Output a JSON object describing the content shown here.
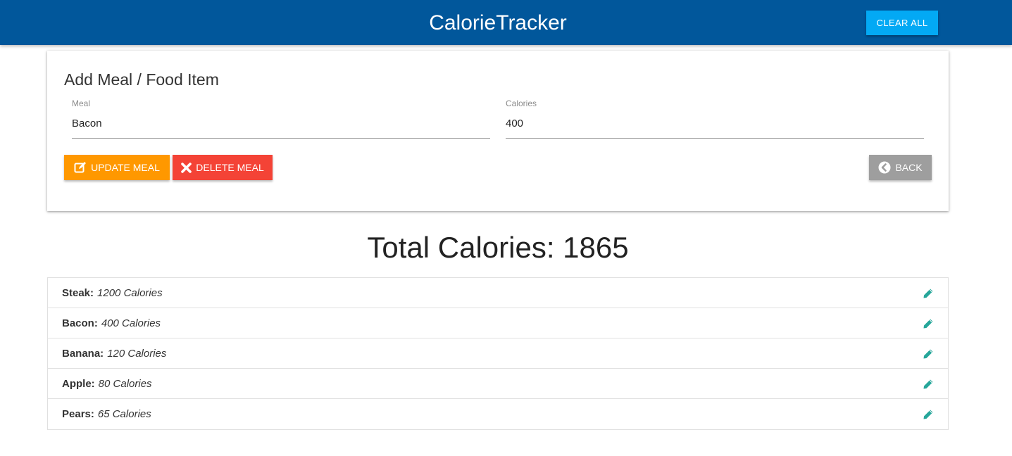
{
  "navbar": {
    "brand": "CalorieTracker",
    "clear_all": "CLEAR ALL"
  },
  "form": {
    "title": "Add Meal / Food Item",
    "meal": {
      "label": "Meal",
      "value": "Bacon"
    },
    "calories": {
      "label": "Calories",
      "value": "400"
    },
    "buttons": {
      "update": "UPDATE MEAL",
      "delete": "DELETE MEAL",
      "back": "BACK"
    }
  },
  "total": {
    "label": "Total Calories:",
    "value": "1865"
  },
  "items": [
    {
      "name": "Steak:",
      "calories": "1200 Calories"
    },
    {
      "name": "Bacon:",
      "calories": "400 Calories"
    },
    {
      "name": "Banana:",
      "calories": "120 Calories"
    },
    {
      "name": "Apple:",
      "calories": "80 Calories"
    },
    {
      "name": "Pears:",
      "calories": "65 Calories"
    }
  ],
  "icons": {
    "update": "edit-square-icon",
    "delete": "x-mark-icon",
    "back": "chevron-circle-left-icon",
    "item_edit": "pencil-icon"
  },
  "colors": {
    "navbar": "#01579b",
    "clear_all": "#03a9f4",
    "update": "#ff9800",
    "delete": "#f44336",
    "back": "#9e9e9e",
    "edit_icon": "#26a69a"
  }
}
